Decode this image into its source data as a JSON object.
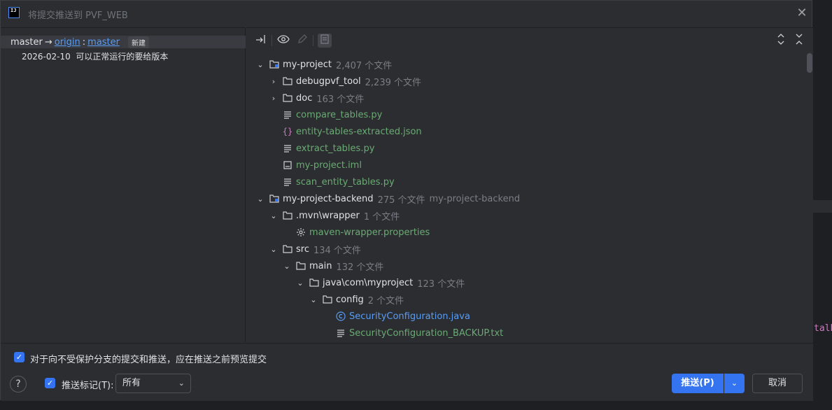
{
  "window": {
    "title": "将提交推送到 PVF_WEB",
    "app_icon": "IJ"
  },
  "push_spec": {
    "source": "master",
    "arrow": "→",
    "remote": "origin",
    "sep": ":",
    "target": "master",
    "badge": "新建"
  },
  "commit": {
    "date": "2026-02-10",
    "message": "可以正常运行的要给版本"
  },
  "tree": [
    {
      "name": "my-project",
      "count": "2,407 个文件",
      "kind": "module",
      "expanded": true
    },
    {
      "name": "debugpvf_tool",
      "count": "2,239 个文件",
      "kind": "folder",
      "expanded": false
    },
    {
      "name": "doc",
      "count": "163 个文件",
      "kind": "folder",
      "expanded": false
    },
    {
      "name": "compare_tables.py",
      "kind": "text"
    },
    {
      "name": "entity-tables-extracted.json",
      "kind": "json"
    },
    {
      "name": "extract_tables.py",
      "kind": "text"
    },
    {
      "name": "my-project.iml",
      "kind": "iml"
    },
    {
      "name": "scan_entity_tables.py",
      "kind": "text"
    },
    {
      "name": "my-project-backend",
      "count": "275 个文件",
      "extra": "my-project-backend",
      "kind": "module",
      "expanded": true
    },
    {
      "name": ".mvn\\wrapper",
      "count": "1 个文件",
      "kind": "folder",
      "expanded": true
    },
    {
      "name": "maven-wrapper.properties",
      "kind": "gear"
    },
    {
      "name": "src",
      "count": "134 个文件",
      "kind": "folder",
      "expanded": true
    },
    {
      "name": "main",
      "count": "132 个文件",
      "kind": "folder",
      "expanded": true
    },
    {
      "name": "java\\com\\myproject",
      "count": "123 个文件",
      "kind": "folder",
      "expanded": true
    },
    {
      "name": "config",
      "count": "2 个文件",
      "kind": "folder",
      "expanded": true
    },
    {
      "name": "SecurityConfiguration.java",
      "kind": "java"
    },
    {
      "name": "SecurityConfiguration_BACKUP.txt",
      "kind": "text"
    }
  ],
  "footer": {
    "preview_checkbox_label": "对于向不受保护分支的提交和推送，应在推送之前预览提交",
    "push_tags_label": "推送标记(T):",
    "tags_select_value": "所有",
    "push_button": "推送(P)",
    "cancel_button": "取消",
    "help": "?"
  },
  "background_code": "talP"
}
